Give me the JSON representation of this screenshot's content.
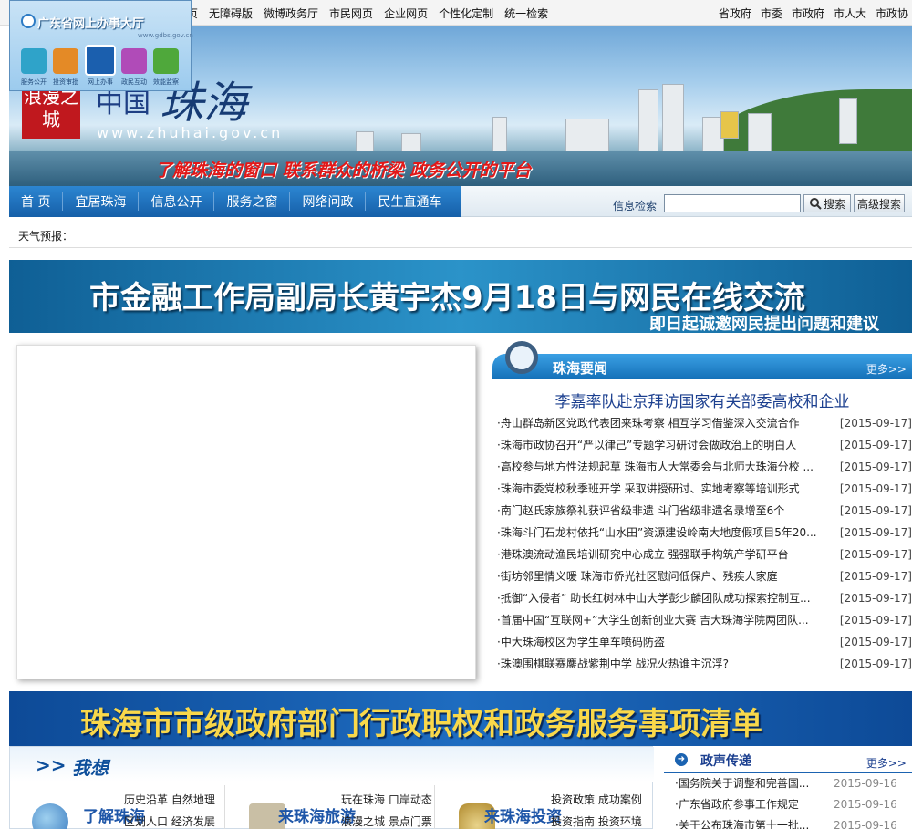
{
  "top_links": [
    "无障碍版",
    "微博政务厅",
    "市民网页",
    "企业网页",
    "个性化定制",
    "统一检索"
  ],
  "top_links_partial": "页",
  "right_links": [
    "省政府",
    "市委",
    "市政府",
    "市人大",
    "市政协"
  ],
  "gd_widget": {
    "title": "广东省网上办事大厅",
    "url": "www.gdbs.gov.cn",
    "items": [
      "服务公开",
      "投资审批",
      "网上办事",
      "政民互动",
      "效能监察"
    ]
  },
  "header": {
    "badge": "浪漫之城",
    "name_small": "中国",
    "name_big": "珠海",
    "url": "www.zhuhai.gov.cn",
    "slogan": "了解珠海的窗口  联系群众的桥梁  政务公开的平台"
  },
  "nav": {
    "items": [
      "首  页",
      "宜居珠海",
      "信息公开",
      "服务之窗",
      "网络问政",
      "民生直通车"
    ],
    "search_label": "信息检索",
    "search_placeholder": "",
    "search_button": "搜索",
    "advanced_button": "高级搜索"
  },
  "weather_label": "天气预报：",
  "promo1": {
    "title": "市金融工作局副局长黄宇杰9月18日与网民在线交流",
    "subtitle": "即日起诚邀网民提出问题和建议"
  },
  "news": {
    "title": "珠海要闻",
    "more": "更多>>",
    "headline": "李嘉率队赴京拜访国家有关部委高校和企业",
    "items": [
      {
        "title": "·舟山群岛新区党政代表团来珠考察  相互学习借鉴深入交流合作",
        "date": "[2015-09-17]"
      },
      {
        "title": "·珠海市政协召开“严以律己”专题学习研讨会做政治上的明白人",
        "date": "[2015-09-17]"
      },
      {
        "title": "·高校参与地方性法规起草  珠海市人大常委会与北师大珠海分校 ...",
        "date": "[2015-09-17]"
      },
      {
        "title": "·珠海市委党校秋季班开学  采取讲授研讨、实地考察等培训形式",
        "date": "[2015-09-17]"
      },
      {
        "title": "·南门赵氏家族祭礼获评省级非遗  斗门省级非遗名录增至6个",
        "date": "[2015-09-17]"
      },
      {
        "title": "·珠海斗门石龙村依托“山水田”资源建设岭南大地度假项目5年20...",
        "date": "[2015-09-17]"
      },
      {
        "title": "·港珠澳流动渔民培训研究中心成立  强强联手构筑产学研平台",
        "date": "[2015-09-17]"
      },
      {
        "title": "·街坊邻里情义暖    珠海市侨光社区慰问低保户、残疾人家庭",
        "date": "[2015-09-17]"
      },
      {
        "title": "·抵御“入侵者”  助长红树林中山大学彭少麟团队成功探索控制互...",
        "date": "[2015-09-17]"
      },
      {
        "title": "·首届中国“互联网+”大学生创新创业大赛  吉大珠海学院两团队...",
        "date": "[2015-09-17]"
      },
      {
        "title": "·中大珠海校区为学生单车喷码防盗",
        "date": "[2015-09-17]"
      },
      {
        "title": "·珠澳围棋联赛鏖战紫荆中学  战况火热谁主沉浮?",
        "date": "[2015-09-17]"
      }
    ]
  },
  "promo2_title": "珠海市市级政府部门行政职权和政务服务事项清单",
  "woxiang": {
    "arrow": ">>",
    "title": "我想",
    "blocks": [
      {
        "name": "了解珠海",
        "links": [
          [
            "历史沿革",
            "自然地理"
          ],
          [
            "区划人口",
            "经济发展"
          ]
        ]
      },
      {
        "name": "来珠海旅游",
        "links": [
          [
            "玩在珠海",
            "口岸动态"
          ],
          [
            "浪漫之城",
            "景点门票"
          ]
        ]
      },
      {
        "name": "来珠海投资",
        "links": [
          [
            "投资政策",
            "成功案例"
          ],
          [
            "投资指南",
            "投资环境"
          ]
        ]
      }
    ]
  },
  "zhengsheng": {
    "title": "政声传递",
    "more": "更多>>",
    "items": [
      {
        "title": "·国务院关于调整和完善国...",
        "date": "2015-09-16"
      },
      {
        "title": "·广东省政府参事工作规定",
        "date": "2015-09-16"
      },
      {
        "title": "·关于公布珠海市第十一批...",
        "date": "2015-09-16"
      }
    ]
  },
  "colors": {
    "nav_blue": "#1a6bb8",
    "slogan_red": "#e21818",
    "headline_blue": "#1b3f8f",
    "promo_yellow": "#f9d84a"
  }
}
